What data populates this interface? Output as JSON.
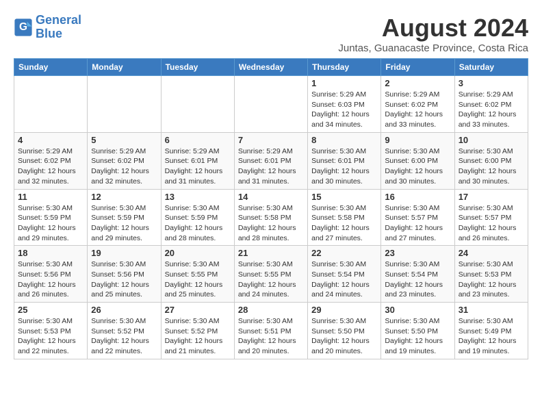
{
  "header": {
    "logo_line1": "General",
    "logo_line2": "Blue",
    "main_title": "August 2024",
    "subtitle": "Juntas, Guanacaste Province, Costa Rica"
  },
  "days_of_week": [
    "Sunday",
    "Monday",
    "Tuesday",
    "Wednesday",
    "Thursday",
    "Friday",
    "Saturday"
  ],
  "weeks": [
    [
      {
        "date": "",
        "info": ""
      },
      {
        "date": "",
        "info": ""
      },
      {
        "date": "",
        "info": ""
      },
      {
        "date": "",
        "info": ""
      },
      {
        "date": "1",
        "info": "Sunrise: 5:29 AM\nSunset: 6:03 PM\nDaylight: 12 hours\nand 34 minutes."
      },
      {
        "date": "2",
        "info": "Sunrise: 5:29 AM\nSunset: 6:02 PM\nDaylight: 12 hours\nand 33 minutes."
      },
      {
        "date": "3",
        "info": "Sunrise: 5:29 AM\nSunset: 6:02 PM\nDaylight: 12 hours\nand 33 minutes."
      }
    ],
    [
      {
        "date": "4",
        "info": "Sunrise: 5:29 AM\nSunset: 6:02 PM\nDaylight: 12 hours\nand 32 minutes."
      },
      {
        "date": "5",
        "info": "Sunrise: 5:29 AM\nSunset: 6:02 PM\nDaylight: 12 hours\nand 32 minutes."
      },
      {
        "date": "6",
        "info": "Sunrise: 5:29 AM\nSunset: 6:01 PM\nDaylight: 12 hours\nand 31 minutes."
      },
      {
        "date": "7",
        "info": "Sunrise: 5:29 AM\nSunset: 6:01 PM\nDaylight: 12 hours\nand 31 minutes."
      },
      {
        "date": "8",
        "info": "Sunrise: 5:30 AM\nSunset: 6:01 PM\nDaylight: 12 hours\nand 30 minutes."
      },
      {
        "date": "9",
        "info": "Sunrise: 5:30 AM\nSunset: 6:00 PM\nDaylight: 12 hours\nand 30 minutes."
      },
      {
        "date": "10",
        "info": "Sunrise: 5:30 AM\nSunset: 6:00 PM\nDaylight: 12 hours\nand 30 minutes."
      }
    ],
    [
      {
        "date": "11",
        "info": "Sunrise: 5:30 AM\nSunset: 5:59 PM\nDaylight: 12 hours\nand 29 minutes."
      },
      {
        "date": "12",
        "info": "Sunrise: 5:30 AM\nSunset: 5:59 PM\nDaylight: 12 hours\nand 29 minutes."
      },
      {
        "date": "13",
        "info": "Sunrise: 5:30 AM\nSunset: 5:59 PM\nDaylight: 12 hours\nand 28 minutes."
      },
      {
        "date": "14",
        "info": "Sunrise: 5:30 AM\nSunset: 5:58 PM\nDaylight: 12 hours\nand 28 minutes."
      },
      {
        "date": "15",
        "info": "Sunrise: 5:30 AM\nSunset: 5:58 PM\nDaylight: 12 hours\nand 27 minutes."
      },
      {
        "date": "16",
        "info": "Sunrise: 5:30 AM\nSunset: 5:57 PM\nDaylight: 12 hours\nand 27 minutes."
      },
      {
        "date": "17",
        "info": "Sunrise: 5:30 AM\nSunset: 5:57 PM\nDaylight: 12 hours\nand 26 minutes."
      }
    ],
    [
      {
        "date": "18",
        "info": "Sunrise: 5:30 AM\nSunset: 5:56 PM\nDaylight: 12 hours\nand 26 minutes."
      },
      {
        "date": "19",
        "info": "Sunrise: 5:30 AM\nSunset: 5:56 PM\nDaylight: 12 hours\nand 25 minutes."
      },
      {
        "date": "20",
        "info": "Sunrise: 5:30 AM\nSunset: 5:55 PM\nDaylight: 12 hours\nand 25 minutes."
      },
      {
        "date": "21",
        "info": "Sunrise: 5:30 AM\nSunset: 5:55 PM\nDaylight: 12 hours\nand 24 minutes."
      },
      {
        "date": "22",
        "info": "Sunrise: 5:30 AM\nSunset: 5:54 PM\nDaylight: 12 hours\nand 24 minutes."
      },
      {
        "date": "23",
        "info": "Sunrise: 5:30 AM\nSunset: 5:54 PM\nDaylight: 12 hours\nand 23 minutes."
      },
      {
        "date": "24",
        "info": "Sunrise: 5:30 AM\nSunset: 5:53 PM\nDaylight: 12 hours\nand 23 minutes."
      }
    ],
    [
      {
        "date": "25",
        "info": "Sunrise: 5:30 AM\nSunset: 5:53 PM\nDaylight: 12 hours\nand 22 minutes."
      },
      {
        "date": "26",
        "info": "Sunrise: 5:30 AM\nSunset: 5:52 PM\nDaylight: 12 hours\nand 22 minutes."
      },
      {
        "date": "27",
        "info": "Sunrise: 5:30 AM\nSunset: 5:52 PM\nDaylight: 12 hours\nand 21 minutes."
      },
      {
        "date": "28",
        "info": "Sunrise: 5:30 AM\nSunset: 5:51 PM\nDaylight: 12 hours\nand 20 minutes."
      },
      {
        "date": "29",
        "info": "Sunrise: 5:30 AM\nSunset: 5:50 PM\nDaylight: 12 hours\nand 20 minutes."
      },
      {
        "date": "30",
        "info": "Sunrise: 5:30 AM\nSunset: 5:50 PM\nDaylight: 12 hours\nand 19 minutes."
      },
      {
        "date": "31",
        "info": "Sunrise: 5:30 AM\nSunset: 5:49 PM\nDaylight: 12 hours\nand 19 minutes."
      }
    ]
  ]
}
